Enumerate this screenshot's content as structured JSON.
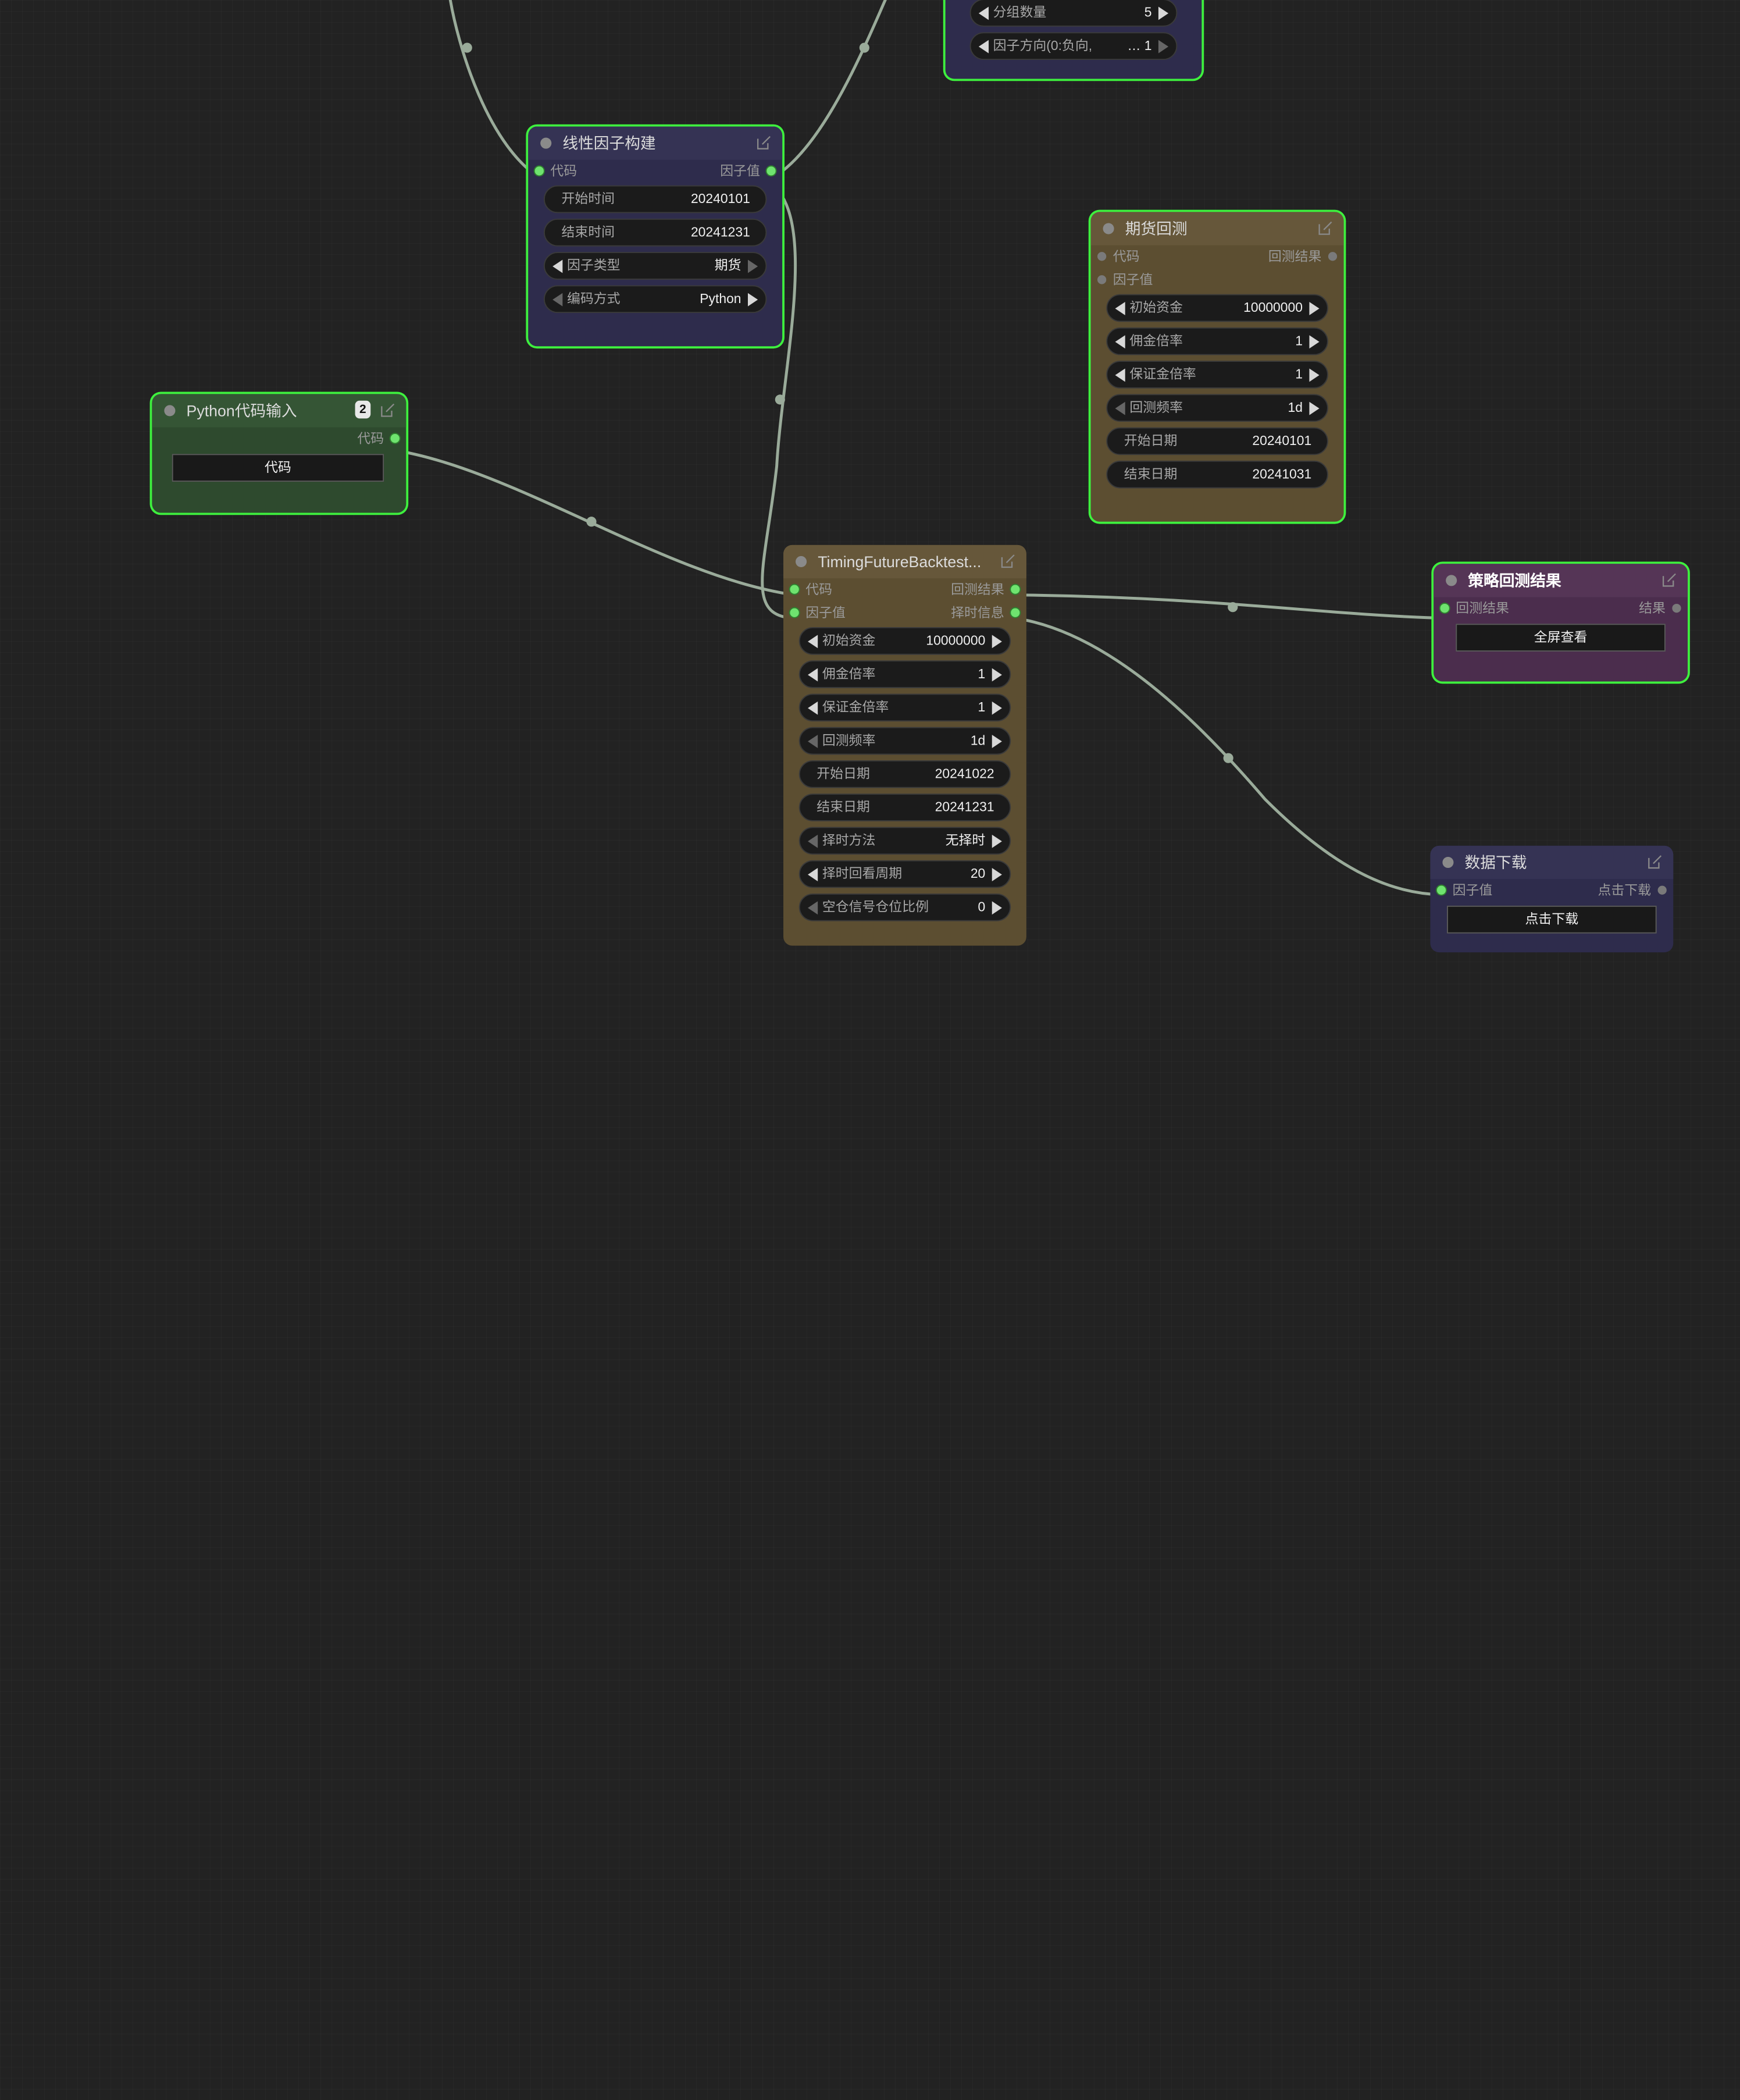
{
  "colors": {
    "wire": "#9aab9a",
    "selected_outline": "#3ef03e",
    "port_active": "#6fe36f"
  },
  "nodes": {
    "top_partial": {
      "widgets": [
        {
          "label": "分组数量",
          "value": "5"
        },
        {
          "label": "因子方向(0:负向,",
          "value": "… 1"
        }
      ]
    },
    "linear_factor": {
      "title": "线性因子构建",
      "inputs": [
        "代码"
      ],
      "outputs": [
        "因子值"
      ],
      "widgets": [
        {
          "label": "开始时间",
          "value": "20240101"
        },
        {
          "label": "结束时间",
          "value": "20241231"
        },
        {
          "label": "因子类型",
          "value": "期货"
        },
        {
          "label": "编码方式",
          "value": "Python"
        }
      ]
    },
    "futures_backtest": {
      "title": "期货回测",
      "inputs": [
        "代码",
        "因子值"
      ],
      "outputs": [
        "回测结果"
      ],
      "widgets": [
        {
          "label": "初始资金",
          "value": "10000000"
        },
        {
          "label": "佣金倍率",
          "value": "1"
        },
        {
          "label": "保证金倍率",
          "value": "1"
        },
        {
          "label": "回测频率",
          "value": "1d"
        },
        {
          "label": "开始日期",
          "value": "20240101"
        },
        {
          "label": "结束日期",
          "value": "20241031"
        }
      ]
    },
    "python_input": {
      "title": "Python代码输入",
      "badge": "2",
      "outputs": [
        "代码"
      ],
      "button": "代码"
    },
    "timing_backtest": {
      "title": "TimingFutureBacktest...",
      "inputs": [
        "代码",
        "因子值"
      ],
      "outputs": [
        "回测结果",
        "择时信息"
      ],
      "widgets": [
        {
          "label": "初始资金",
          "value": "10000000"
        },
        {
          "label": "佣金倍率",
          "value": "1"
        },
        {
          "label": "保证金倍率",
          "value": "1"
        },
        {
          "label": "回测频率",
          "value": "1d"
        },
        {
          "label": "开始日期",
          "value": "20241022"
        },
        {
          "label": "结束日期",
          "value": "20241231"
        },
        {
          "label": "择时方法",
          "value": "无择时"
        },
        {
          "label": "择时回看周期",
          "value": "20"
        },
        {
          "label": "空仓信号仓位比例",
          "value": "0"
        }
      ]
    },
    "strategy_result": {
      "title": "策略回测结果",
      "inputs": [
        "回测结果"
      ],
      "outputs": [
        "结果"
      ],
      "button": "全屏查看"
    },
    "data_download": {
      "title": "数据下载",
      "inputs": [
        "因子值"
      ],
      "outputs": [
        "点击下载"
      ],
      "button": "点击下载"
    }
  }
}
